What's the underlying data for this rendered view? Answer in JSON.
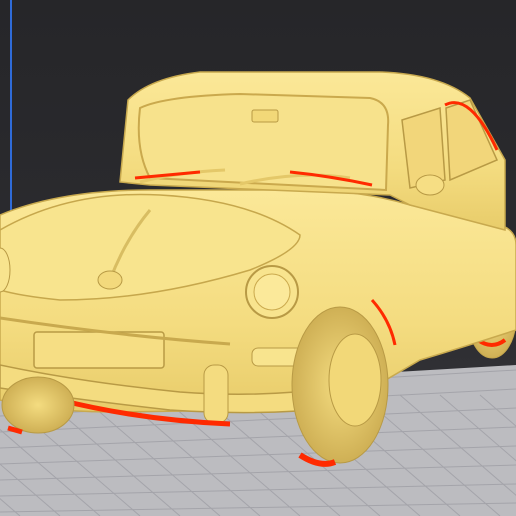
{
  "viewer": {
    "background": "#2a2a2e",
    "plate_fill": "#bcbcc0",
    "plate_grid": "#9c9ca2",
    "axis_color": "#2f6bd8"
  },
  "model": {
    "icon": "car-model",
    "body_color": "#f6e08a",
    "shade_color": "#d9bd5c",
    "dark_shade_color": "#b89a45",
    "overhang_highlight_color": "#ff2a00"
  }
}
